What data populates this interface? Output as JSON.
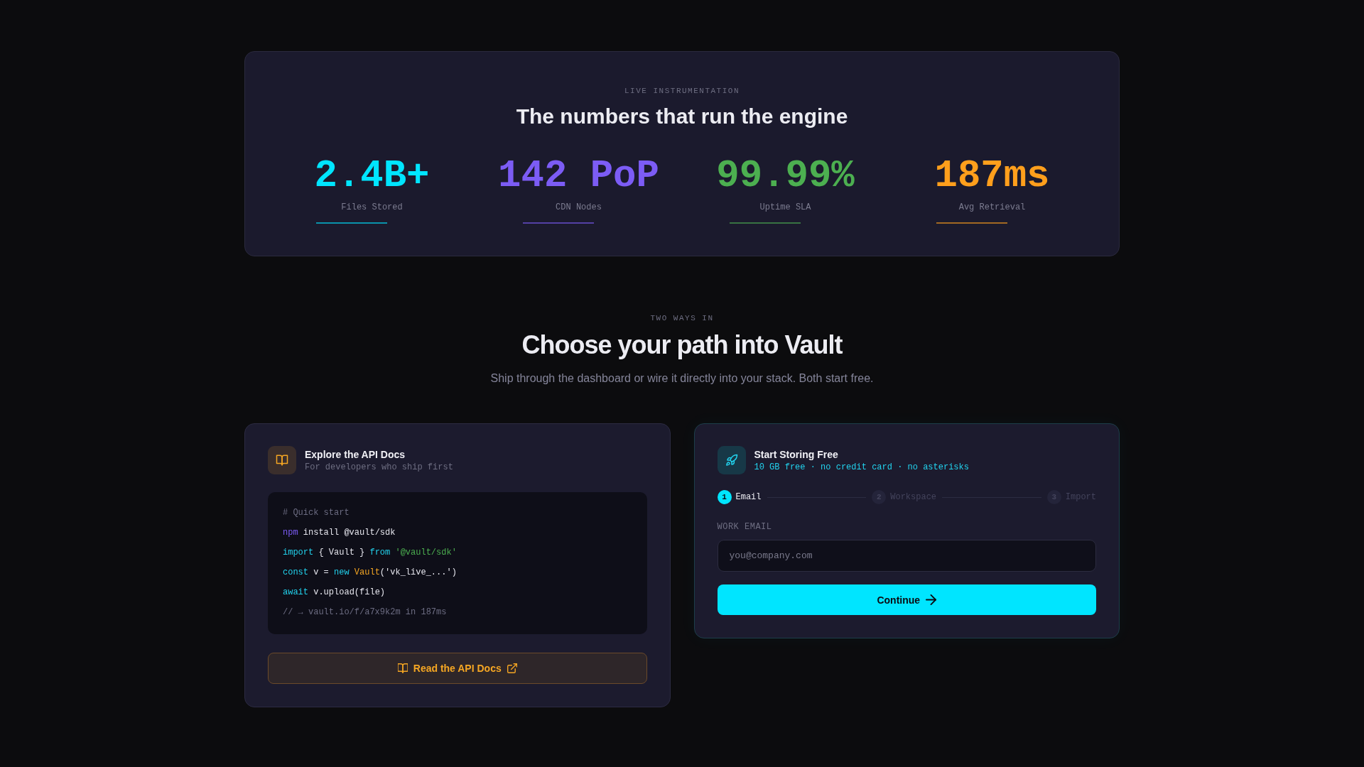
{
  "stats_panel": {
    "eyebrow": "LIVE INSTRUMENTATION",
    "title": "The numbers that run the engine",
    "stats": [
      {
        "value": "2.4B+",
        "label": "Files Stored",
        "color": "#00e5ff"
      },
      {
        "value": "142 PoP",
        "label": "CDN Nodes",
        "color": "#7c5cf5"
      },
      {
        "value": "99.99%",
        "label": "Uptime SLA",
        "color": "#4caf50"
      },
      {
        "value": "187ms",
        "label": "Avg Retrieval",
        "color": "#ff9f1c"
      }
    ]
  },
  "section": {
    "eyebrow": "TWO WAYS IN",
    "title": "Choose your path into Vault",
    "subtitle": "Ship through the dashboard or wire it directly into your stack. Both start free."
  },
  "docs_card": {
    "title": "Explore the API Docs",
    "subtitle": "For developers who ship first",
    "code": [
      [
        {
          "kind": "comment",
          "text": "# Quick start"
        }
      ],
      [
        {
          "kind": "command",
          "text": "npm"
        },
        {
          "kind": "plain",
          "text": " install @vault/sdk"
        }
      ],
      [
        {
          "kind": "keyword",
          "text": "import"
        },
        {
          "kind": "plain",
          "text": " { Vault } "
        },
        {
          "kind": "keyword",
          "text": "from"
        },
        {
          "kind": "string",
          "text": " '@vault/sdk'"
        }
      ],
      [
        {
          "kind": "keyword",
          "text": "const"
        },
        {
          "kind": "plain",
          "text": " v = "
        },
        {
          "kind": "keyword",
          "text": "new"
        },
        {
          "kind": "class",
          "text": " Vault"
        },
        {
          "kind": "plain",
          "text": "('vk_live_...')"
        }
      ],
      [
        {
          "kind": "keyword",
          "text": "await"
        },
        {
          "kind": "plain",
          "text": " v.upload(file)"
        }
      ],
      [
        {
          "kind": "comment",
          "text": "// → vault.io/f/a7x9k2m in 187ms"
        }
      ]
    ],
    "button": "Read the API Docs"
  },
  "signup_card": {
    "title": "Start Storing Free",
    "subtitle": "10 GB free · no credit card · no asterisks",
    "steps": [
      {
        "number": "1",
        "label": "Email",
        "active": true
      },
      {
        "number": "2",
        "label": "Workspace",
        "active": false
      },
      {
        "number": "3",
        "label": "Import",
        "active": false
      }
    ],
    "field": {
      "label": "WORK EMAIL",
      "placeholder": "you@company.com"
    },
    "button": "Continue"
  }
}
